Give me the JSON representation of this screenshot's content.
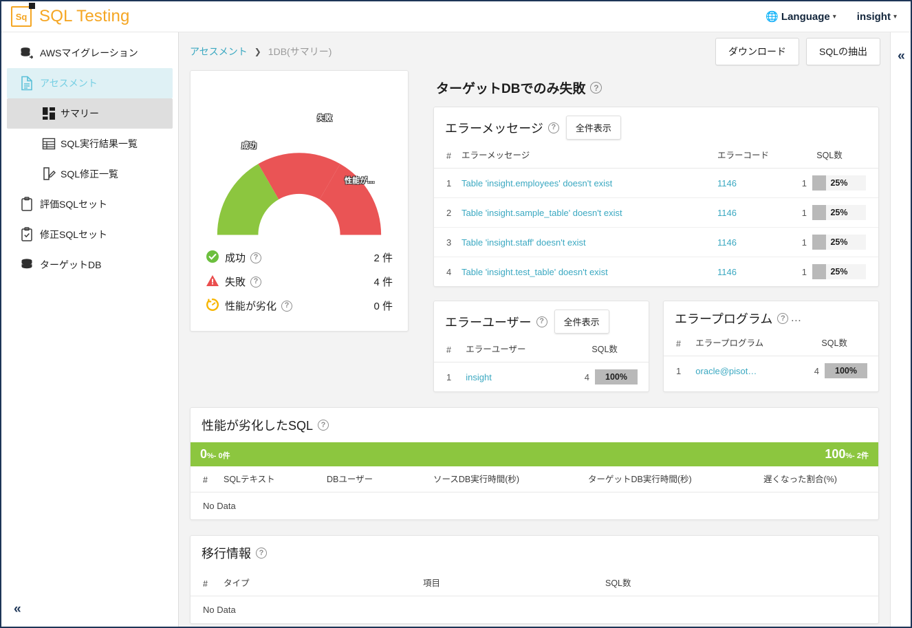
{
  "header": {
    "brand_mark": "Sq",
    "brand_title": "SQL Testing",
    "language_label": "Language",
    "language_icon": "globe-icon",
    "user_label": "insight",
    "caret": "⌄"
  },
  "sidebar": {
    "items": [
      {
        "label": "AWSマイグレーション",
        "icon": "database-arrow-icon",
        "state": "normal",
        "level": "top"
      },
      {
        "label": "アセスメント",
        "icon": "document-icon",
        "state": "active-primary",
        "level": "top"
      },
      {
        "label": "サマリー",
        "icon": "grid-icon",
        "state": "active-sub",
        "level": "sub"
      },
      {
        "label": "SQL実行結果一覧",
        "icon": "table-icon",
        "state": "normal",
        "level": "sub"
      },
      {
        "label": "SQL修正一覧",
        "icon": "document-edit-icon",
        "state": "normal",
        "level": "sub"
      },
      {
        "label": "評価SQLセット",
        "icon": "clipboard-icon",
        "state": "normal",
        "level": "top"
      },
      {
        "label": "修正SQLセット",
        "icon": "clipboard-check-icon",
        "state": "normal",
        "level": "top"
      },
      {
        "label": "ターゲットDB",
        "icon": "database-icon",
        "state": "normal",
        "level": "top"
      }
    ],
    "collapse_icon": "chevron-double-left-icon"
  },
  "topbar": {
    "breadcrumb_link": "アセスメント",
    "breadcrumb_sep": "❯",
    "breadcrumb_current": "1DB(サマリー)",
    "download_button": "ダウンロード",
    "extract_button": "SQLの抽出",
    "rail_collapse_icon": "chevron-double-left-icon"
  },
  "gauge": {
    "help_icon": "?",
    "labels": {
      "success": "成功",
      "failure": "失敗",
      "degraded": "性能が…"
    },
    "legend": [
      {
        "icon": "check-circle-icon",
        "label": "成功",
        "value": "2 件",
        "color": "#6cbf3e"
      },
      {
        "icon": "warning-triangle-icon",
        "label": "失敗",
        "value": "4 件",
        "color": "#ea4e4e"
      },
      {
        "icon": "gauge-icon",
        "label": "性能が劣化",
        "value": "0 件",
        "color": "#f7b500"
      }
    ]
  },
  "chart_data": {
    "type": "pie",
    "title": "アセスメント結果",
    "variant": "half-donut-gauge",
    "categories": [
      "成功",
      "失敗",
      "性能が劣化"
    ],
    "values": [
      2,
      4,
      0
    ],
    "percents": [
      33.3,
      66.7,
      0
    ],
    "colors": [
      "#8cc63f",
      "#ea5455",
      "#f7b500"
    ],
    "unit": "件",
    "legend_position": "below",
    "start_angle_deg": 180,
    "end_angle_deg": 0
  },
  "target_fail_section": {
    "title": "ターゲットDBでのみ失敗",
    "title_bold_part": "DB",
    "help_icon": "?"
  },
  "error_message_panel": {
    "title": "エラーメッセージ",
    "help_icon": "?",
    "show_all_button": "全件表示",
    "columns": [
      "#",
      "エラーメッセージ",
      "エラーコード",
      "SQL数"
    ],
    "rows": [
      {
        "idx": "1",
        "message": "Table 'insight.employees' doesn't exist",
        "code": "1146",
        "count": "1",
        "pct_text": "25%",
        "pct": 25
      },
      {
        "idx": "2",
        "message": "Table 'insight.sample_table' doesn't exist",
        "code": "1146",
        "count": "1",
        "pct_text": "25%",
        "pct": 25
      },
      {
        "idx": "3",
        "message": "Table 'insight.staff' doesn't exist",
        "code": "1146",
        "count": "1",
        "pct_text": "25%",
        "pct": 25
      },
      {
        "idx": "4",
        "message": "Table 'insight.test_table' doesn't exist",
        "code": "1146",
        "count": "1",
        "pct_text": "25%",
        "pct": 25
      }
    ]
  },
  "error_user_panel": {
    "title": "エラーユーザー",
    "help_icon": "?",
    "show_all_button": "全件表示",
    "columns": [
      "#",
      "エラーユーザー",
      "SQL数"
    ],
    "rows": [
      {
        "idx": "1",
        "user": "insight",
        "count": "4",
        "pct_text": "100%",
        "pct": 100
      }
    ]
  },
  "error_program_panel": {
    "title": "エラープログラム",
    "help_icon": "?",
    "overflow_mark": "…",
    "columns": [
      "#",
      "エラープログラム",
      "SQL数"
    ],
    "rows": [
      {
        "idx": "1",
        "program": "oracle@pisot…",
        "count": "4",
        "pct_text": "100%",
        "pct": 100
      }
    ]
  },
  "degraded_sql_panel": {
    "title": "性能が劣化したSQL",
    "title_bold_part": "SQL",
    "help_icon": "?",
    "bar_left_big": "0",
    "bar_left_pct": "%",
    "bar_left_sub": "- 0件",
    "bar_right_big": "100",
    "bar_right_pct": "%",
    "bar_right_sub": "- 2件",
    "bar_color": "#8cc63f",
    "columns": [
      "#",
      "SQLテキスト",
      "DBユーザー",
      "ソースDB実行時間(秒)",
      "ターゲットDB実行時間(秒)",
      "遅くなった割合(%)"
    ],
    "empty_text": "No Data"
  },
  "migration_panel": {
    "title": "移行情報",
    "help_icon": "?",
    "columns": [
      "#",
      "タイプ",
      "項目",
      "SQL数"
    ],
    "empty_text": "No Data"
  }
}
